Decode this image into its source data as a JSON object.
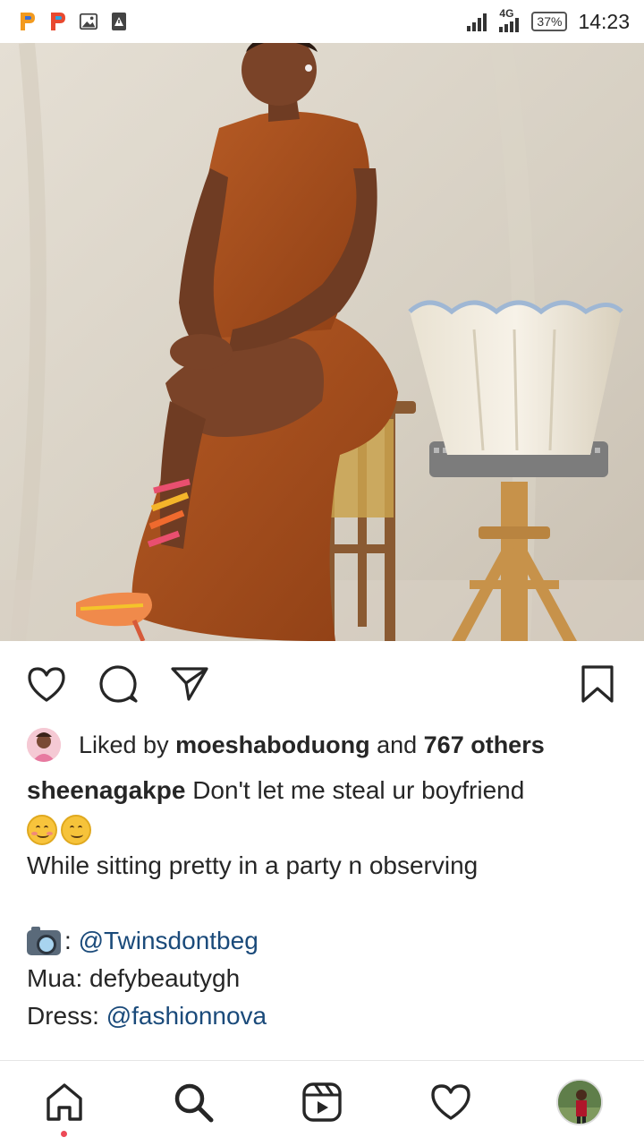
{
  "status_bar": {
    "network": "4G",
    "battery": "37%",
    "time": "14:23"
  },
  "post": {
    "image_alt": "Woman in orange dress seated on a wooden stool beside a lampshade",
    "likes": {
      "prefix": "Liked by ",
      "user": "moeshaboduong",
      "middle": " and ",
      "count": "767 others"
    },
    "caption": {
      "author": "sheenagakpe",
      "line1_text": " Don't let me steal ur boyfriend",
      "line3": "While sitting pretty in a party n observing",
      "photo_credit_sep": ": ",
      "photo_credit": "@Twinsdontbeg",
      "mua_label": "Mua: ",
      "mua_value": "defybeautygh",
      "dress_label": "Dress: ",
      "dress_value": "@fashionnova"
    }
  },
  "colors": {
    "link": "#1a4a7a",
    "notification_dot": "#ed4956",
    "text": "#262626"
  },
  "icons": {
    "like": "heart-icon",
    "comment": "comment-icon",
    "share": "send-icon",
    "save": "bookmark-icon",
    "home": "home-icon",
    "search": "search-icon",
    "reels": "reels-icon",
    "activity": "heart-icon"
  }
}
